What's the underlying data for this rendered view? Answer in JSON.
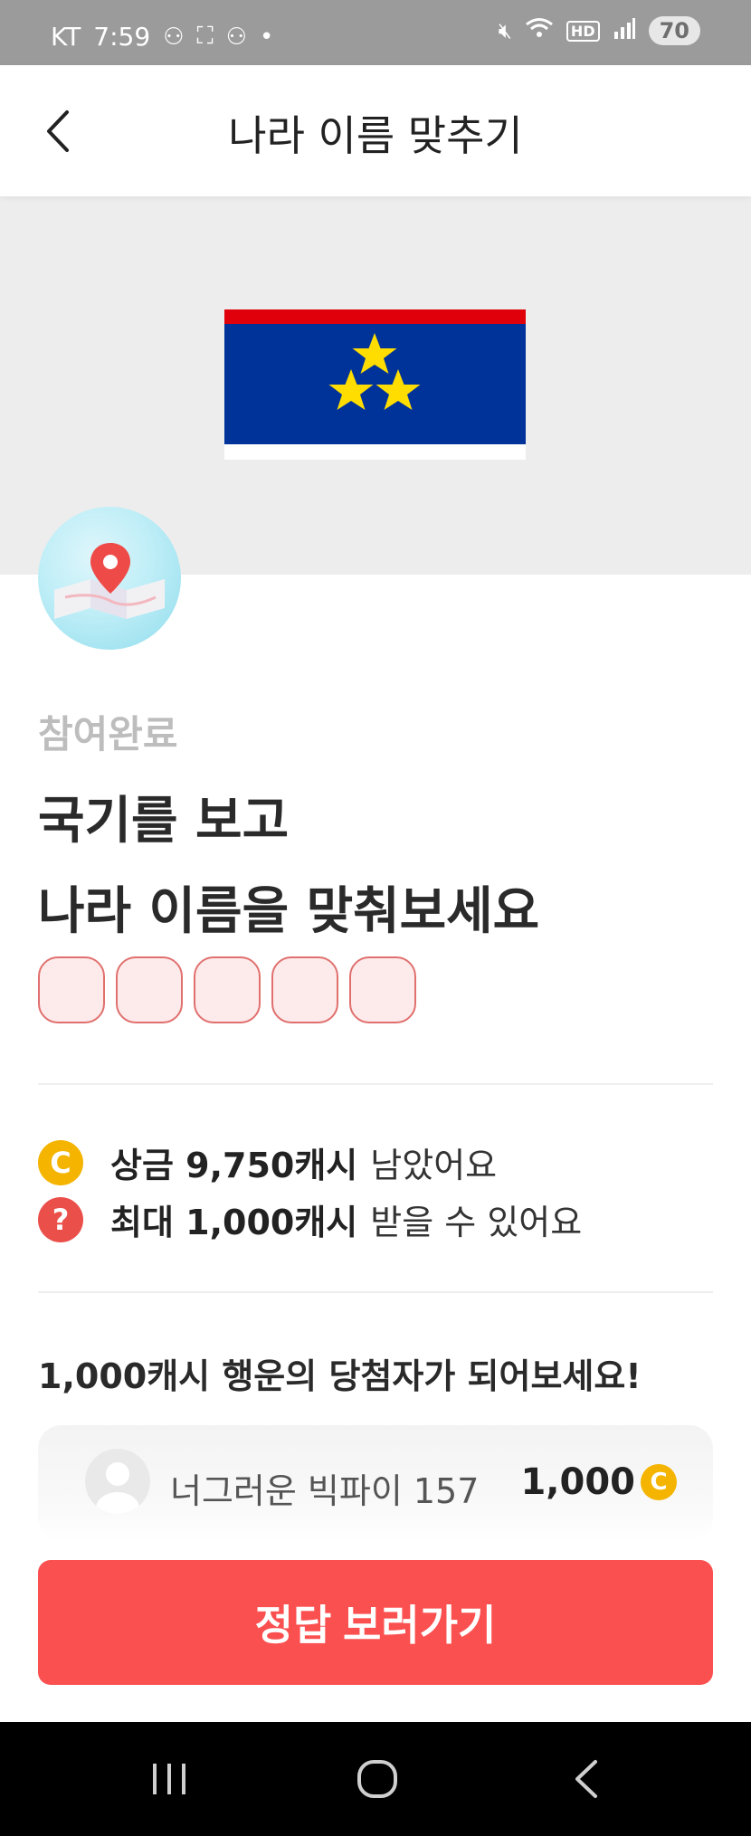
{
  "status_bar": {
    "carrier": "KT",
    "time": "7:59",
    "battery": "70",
    "notification_icons": [
      "record-icon",
      "screenshot-icon",
      "record-icon",
      "dot-icon"
    ],
    "system_icons": [
      "mute-icon",
      "wifi-icon",
      "hd-icon",
      "signal-icon"
    ]
  },
  "header": {
    "title": "나라 이름 맞추기"
  },
  "quiz": {
    "status": "참여완료",
    "question_line1": "국기를 보고",
    "question_line2": "나라 이름을 맞춰보세요",
    "answer_box_count": 5
  },
  "info": {
    "prize_bold": "상금 9,750캐시",
    "prize_rest": "남았어요",
    "max_bold": "최대 1,000캐시",
    "max_rest": "받을 수 있어요",
    "coin_glyph": "C",
    "help_glyph": "?"
  },
  "luck": {
    "title": "1,000캐시 행운의 당첨자가 되어보세요!",
    "winner_name": "너그러운 빅파이 157",
    "winner_amount": "1,000"
  },
  "cta": {
    "label": "정답 보러가기"
  },
  "colors": {
    "accent": "#fb5050",
    "coin": "#f4b400",
    "flag_blue": "#003399",
    "flag_red": "#e0000b",
    "flag_star": "#ffdd00"
  }
}
